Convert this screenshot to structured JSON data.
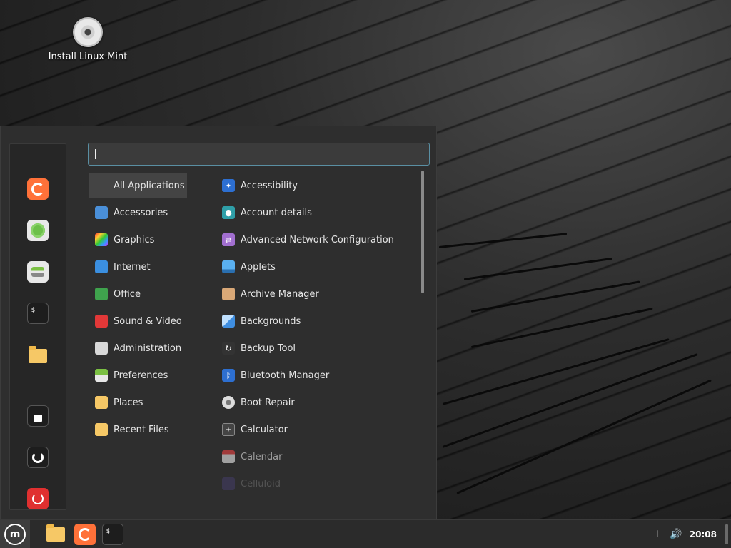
{
  "desktop": {
    "icons": [
      {
        "label": "Install Linux Mint",
        "icon": "cd-disc-icon"
      }
    ]
  },
  "menu": {
    "search": {
      "value": "",
      "placeholder": ""
    },
    "favorites": [
      {
        "name": "firefox",
        "icon": "firefox-icon"
      },
      {
        "name": "software-manager",
        "icon": "software-manager-icon"
      },
      {
        "name": "system-settings",
        "icon": "settings-toggle-icon"
      },
      {
        "name": "terminal",
        "icon": "terminal-icon"
      },
      {
        "name": "files",
        "icon": "folder-icon"
      },
      {
        "name": "lock-screen",
        "icon": "lock-icon"
      },
      {
        "name": "logout",
        "icon": "logout-icon"
      },
      {
        "name": "quit",
        "icon": "power-icon"
      }
    ],
    "categories": [
      {
        "label": "All Applications",
        "selected": true
      },
      {
        "label": "Accessories"
      },
      {
        "label": "Graphics"
      },
      {
        "label": "Internet"
      },
      {
        "label": "Office"
      },
      {
        "label": "Sound & Video"
      },
      {
        "label": "Administration"
      },
      {
        "label": "Preferences"
      },
      {
        "label": "Places"
      },
      {
        "label": "Recent Files"
      }
    ],
    "apps": [
      {
        "label": "Accessibility"
      },
      {
        "label": "Account details"
      },
      {
        "label": "Advanced Network Configuration"
      },
      {
        "label": "Applets"
      },
      {
        "label": "Archive Manager"
      },
      {
        "label": "Backgrounds"
      },
      {
        "label": "Backup Tool"
      },
      {
        "label": "Bluetooth Manager"
      },
      {
        "label": "Boot Repair"
      },
      {
        "label": "Calculator"
      },
      {
        "label": "Calendar"
      },
      {
        "label": "Celluloid"
      }
    ]
  },
  "panel": {
    "launchers": [
      {
        "name": "files",
        "icon": "folder-icon"
      },
      {
        "name": "firefox",
        "icon": "firefox-icon"
      },
      {
        "name": "terminal",
        "icon": "terminal-icon"
      }
    ],
    "clock": "20:08",
    "terminal_glyph": "$_"
  },
  "colors": {
    "accent": "#5a8fa3",
    "menu_bg": "#2e2e2e",
    "panel_bg": "#2b2b2b"
  }
}
